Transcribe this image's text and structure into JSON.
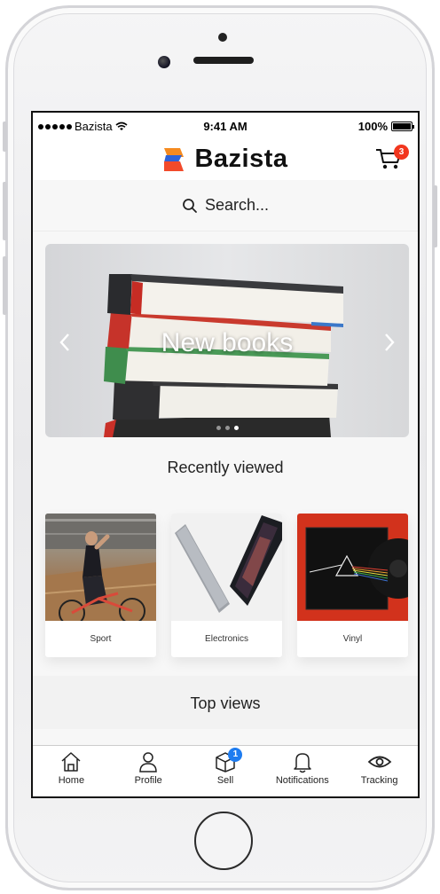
{
  "statusbar": {
    "carrier": "Bazista",
    "time": "9:41 AM",
    "battery": "100%"
  },
  "header": {
    "brand": "Bazista",
    "cart_count": "3"
  },
  "search": {
    "placeholder": "Search..."
  },
  "banner": {
    "title": "New books",
    "slide_index": 3,
    "slide_total": 3
  },
  "recently_viewed": {
    "title": "Recently viewed",
    "items": [
      {
        "label": "Sport"
      },
      {
        "label": "Electronics"
      },
      {
        "label": "Vinyl"
      }
    ]
  },
  "top_views": {
    "title": "Top views"
  },
  "tabbar": {
    "items": [
      {
        "label": "Home",
        "icon": "home-icon"
      },
      {
        "label": "Profile",
        "icon": "user-icon"
      },
      {
        "label": "Sell",
        "icon": "box-icon",
        "badge": "1"
      },
      {
        "label": "Notifications",
        "icon": "bell-icon"
      },
      {
        "label": "Tracking",
        "icon": "eye-icon"
      }
    ]
  },
  "colors": {
    "cart_badge": "#f2361e",
    "sell_badge": "#1e7cf0"
  }
}
